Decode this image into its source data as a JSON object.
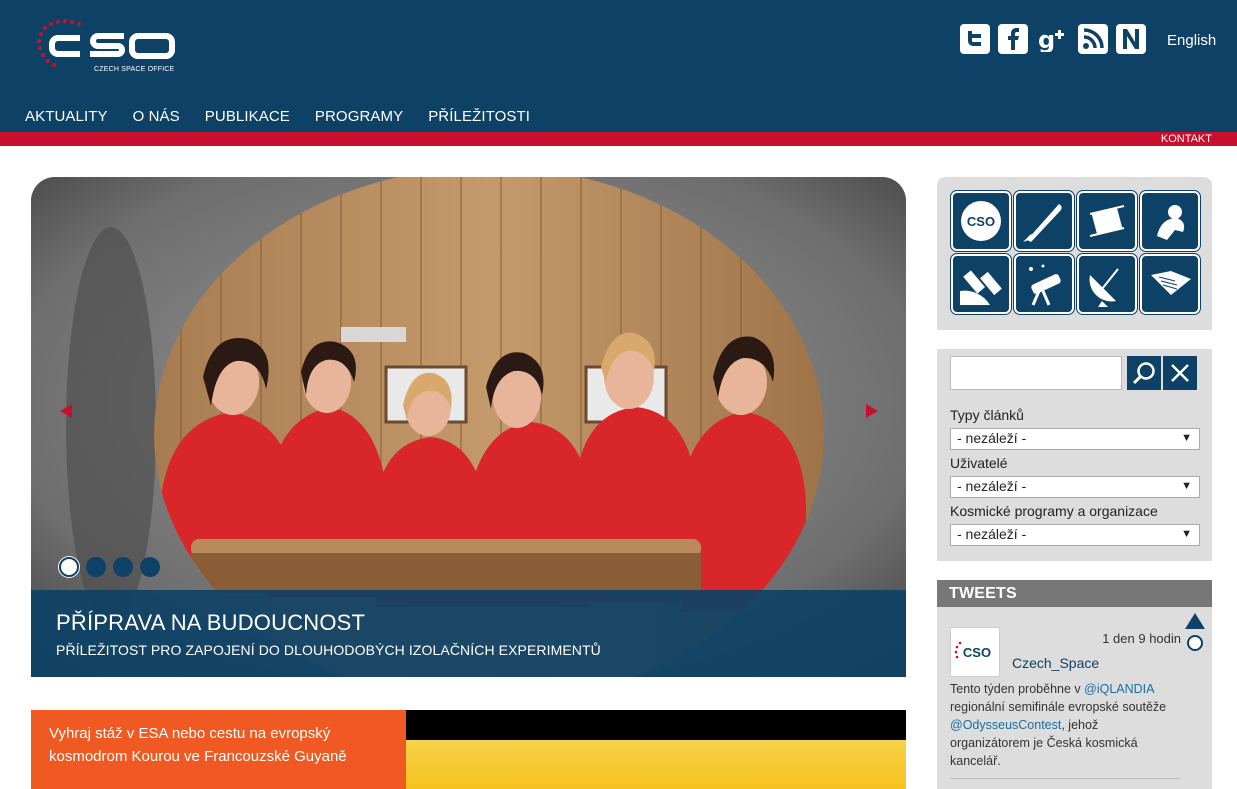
{
  "logo": {
    "name": "CSO",
    "subtitle": "CZECH SPACE OFFICE"
  },
  "social": [
    {
      "name": "twitter-icon",
      "glyph": "t"
    },
    {
      "name": "facebook-icon",
      "glyph": "f"
    },
    {
      "name": "google-plus-icon",
      "glyph": "g+"
    },
    {
      "name": "rss-icon",
      "glyph": "rss"
    },
    {
      "name": "n-icon",
      "glyph": "N"
    }
  ],
  "language": "English",
  "nav": [
    "AKTUALITY",
    "O NÁS",
    "PUBLIKACE",
    "PROGRAMY",
    "PŘÍLEŽITOSTI"
  ],
  "kontakt": "KONTAKT",
  "slider": {
    "title": "PŘÍPRAVA NA BUDOUCNOST",
    "subtitle": "PŘÍLEŽITOST PRO ZAPOJENÍ DO DLOUHODOBÝCH IZOLAČNÍCH EXPERIMENTŮ",
    "dots": 4,
    "active_dot": 1
  },
  "promo": {
    "text": "Vyhraj stáž v ESA nebo cestu na evropský kosmodrom Kourou ve Francouzské Guyaně"
  },
  "icon_tiles": [
    "cso-logo-icon",
    "rocket-icon",
    "chip-icon",
    "astronaut-icon",
    "satellite-icon",
    "telescope-icon",
    "antenna-dish-icon",
    "book-icon"
  ],
  "search": {
    "placeholder": "",
    "filters": [
      {
        "label": "Typy článků",
        "value": "- nezáleží -"
      },
      {
        "label": "Uživatelé",
        "value": "- nezáleží -"
      },
      {
        "label": "Kosmické programy a organizace",
        "value": "- nezáleží -"
      }
    ]
  },
  "tweets": {
    "header": "TWEETS",
    "items": [
      {
        "time": "1 den 9 hodin",
        "handle": "Czech_Space",
        "text_parts": [
          {
            "t": "Tento týden proběhne v ",
            "link": false
          },
          {
            "t": "@iQLANDIA",
            "link": true
          },
          {
            "t": " regionální semifinále evropské soutěže ",
            "link": false
          },
          {
            "t": "@OdysseusContest",
            "link": true
          },
          {
            "t": ", jehož organizátorem je Česká kosmická kancelář.",
            "link": false
          }
        ]
      }
    ]
  },
  "colors": {
    "brand_blue": "#0d4166",
    "accent_red": "#c8102e",
    "promo_orange": "#f05a22",
    "panel_grey": "#dddddd"
  }
}
